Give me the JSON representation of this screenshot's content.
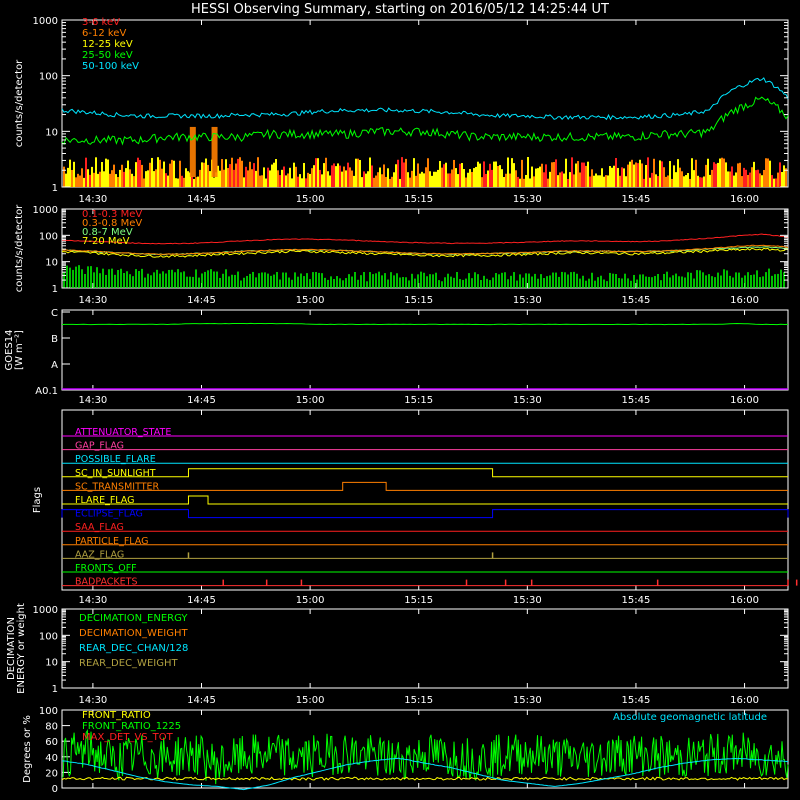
{
  "title": "HESSI Observing Summary, starting on 2016/05/12 14:25:44 UT",
  "time_ticks": [
    "14:30",
    "14:45",
    "15:00",
    "15:15",
    "15:30",
    "15:45",
    "16:00"
  ],
  "colors": {
    "background": "#000000",
    "axes": "#ffffff",
    "red": "#ff2020",
    "orange": "#ff7f00",
    "yellow": "#ffff00",
    "green": "#00ff00",
    "cyan": "#00e5ff",
    "magenta": "#ff00ff",
    "blue": "#0000ff",
    "olive": "#b0a040",
    "pink": "#ff40a0",
    "purple": "#c000ff",
    "lightgreen": "#80ff80",
    "darkred": "#ff3030"
  },
  "chart_data": [
    {
      "id": "low-energy",
      "type": "line",
      "ylabel": "counts/s/detector",
      "yscale": "log",
      "ylim": [
        1,
        1000
      ],
      "yticks": [
        "1",
        "10",
        "100",
        "1000"
      ],
      "series": [
        {
          "name": "3-6 keV",
          "color": "red",
          "values": [
            1,
            2,
            2,
            1,
            2,
            4,
            2,
            1,
            1,
            2,
            1,
            1,
            1,
            1,
            1,
            1,
            1,
            1,
            1,
            1,
            1,
            1,
            1,
            1,
            2,
            2,
            3,
            2,
            1
          ]
        },
        {
          "name": "6-12 keV",
          "color": "orange",
          "values": [
            2,
            2,
            2,
            2,
            3,
            12,
            12,
            2,
            2,
            2,
            2,
            2,
            2,
            2,
            2,
            2,
            2,
            2,
            2,
            2,
            2,
            2,
            2,
            2,
            2,
            2,
            2,
            2,
            2
          ]
        },
        {
          "name": "12-25 keV",
          "color": "yellow",
          "values": [
            2,
            2,
            2,
            2,
            2,
            3,
            3,
            2,
            2,
            2,
            2,
            2,
            2,
            2,
            2,
            2,
            2,
            2,
            2,
            2,
            2,
            2,
            2,
            2,
            2,
            2,
            3,
            3,
            2
          ]
        },
        {
          "name": "25-50 keV",
          "color": "green",
          "values": [
            7,
            7,
            7,
            7,
            8,
            8,
            8,
            8,
            9,
            9,
            9,
            9,
            10,
            10,
            10,
            9,
            8,
            8,
            8,
            8,
            8,
            8,
            8,
            9,
            9,
            10,
            25,
            38,
            18
          ]
        },
        {
          "name": "50-100 keV",
          "color": "cyan",
          "values": [
            24,
            22,
            20,
            19,
            19,
            19,
            19,
            20,
            20,
            21,
            23,
            24,
            24,
            24,
            23,
            22,
            20,
            19,
            19,
            18,
            18,
            18,
            18,
            19,
            20,
            24,
            60,
            90,
            40
          ]
        }
      ]
    },
    {
      "id": "high-energy",
      "type": "line",
      "ylabel": "counts/s/detector",
      "yscale": "log",
      "ylim": [
        1,
        1000
      ],
      "yticks": [
        "1",
        "10",
        "100",
        "1000"
      ],
      "series": [
        {
          "name": "0.1-0.3 MeV",
          "color": "red",
          "values": [
            65,
            60,
            55,
            50,
            48,
            50,
            55,
            62,
            68,
            72,
            70,
            66,
            60,
            55,
            52,
            50,
            50,
            52,
            55,
            60,
            62,
            60,
            58,
            60,
            68,
            78,
            95,
            110,
            85
          ]
        },
        {
          "name": "0.3-0.8 MeV",
          "color": "orange",
          "values": [
            28,
            26,
            22,
            20,
            19,
            20,
            22,
            25,
            27,
            29,
            28,
            26,
            24,
            22,
            20,
            20,
            20,
            21,
            22,
            25,
            26,
            25,
            24,
            25,
            28,
            32,
            38,
            42,
            36
          ]
        },
        {
          "name": "0.8-7 MeV",
          "color": "lightgreen",
          "values": [
            28,
            25,
            22,
            20,
            19,
            20,
            22,
            25,
            27,
            28,
            28,
            26,
            24,
            22,
            20,
            19,
            20,
            21,
            22,
            24,
            25,
            25,
            24,
            25,
            27,
            30,
            34,
            36,
            32
          ]
        },
        {
          "name": "7-20 MeV",
          "color": "yellow",
          "values": [
            24,
            22,
            19,
            17,
            16,
            17,
            19,
            21,
            23,
            25,
            24,
            22,
            20,
            19,
            17,
            17,
            17,
            18,
            19,
            21,
            22,
            21,
            20,
            21,
            23,
            26,
            28,
            30,
            27
          ]
        },
        {
          "name": "",
          "color": "green",
          "values": [
            6,
            5,
            5,
            4,
            4,
            4,
            4,
            3,
            3,
            3,
            3,
            3,
            3,
            3,
            3,
            3,
            3,
            3,
            3,
            3,
            3,
            3,
            3,
            3,
            3,
            4,
            4,
            4,
            4
          ]
        }
      ]
    },
    {
      "id": "goes",
      "type": "line",
      "ylabel": "GOES14",
      "ylabel2": "[W m⁻²]",
      "yticks": [
        "A0.1",
        "A",
        "B",
        "C"
      ],
      "series": [
        {
          "name": "",
          "color": "green",
          "values": [
            0.82,
            0.82,
            0.82,
            0.82,
            0.82,
            0.83,
            0.83,
            0.83,
            0.83,
            0.83,
            0.82,
            0.82,
            0.82,
            0.82,
            0.82,
            0.82,
            0.82,
            0.82,
            0.82,
            0.82,
            0.82,
            0.82,
            0.82,
            0.82,
            0.82,
            0.82,
            0.83,
            0.82,
            0.82
          ]
        }
      ]
    },
    {
      "id": "flags",
      "type": "line",
      "ylabel": "Flags",
      "flags": [
        {
          "label": "ATTENUATOR_STATE",
          "color": "magenta"
        },
        {
          "label": "GAP_FLAG",
          "color": "pink"
        },
        {
          "label": "POSSIBLE_FLARE",
          "color": "cyan"
        },
        {
          "label": "SC_IN_SUNLIGHT",
          "color": "yellow",
          "high_intervals": [
            [
              14.72,
              15.42
            ]
          ]
        },
        {
          "label": "SC_TRANSMITTER",
          "color": "orange",
          "high_intervals": [
            [
              15.075,
              15.175
            ]
          ]
        },
        {
          "label": "FLARE_FLAG",
          "color": "yellow",
          "high_intervals": [
            [
              14.72,
              14.765
            ]
          ]
        },
        {
          "label": "ECLIPSE_FLAG",
          "color": "blue",
          "high_intervals": [
            [
              14.37,
              14.72
            ],
            [
              15.42,
              16.1
            ]
          ]
        },
        {
          "label": "SAA_FLAG",
          "color": "red"
        },
        {
          "label": "PARTICLE_FLAG",
          "color": "orange"
        },
        {
          "label": "AAZ_FLAG",
          "color": "olive",
          "spikes": [
            14.72,
            15.42
          ]
        },
        {
          "label": "FRONTS_OFF",
          "color": "green"
        },
        {
          "label": "BADPACKETS",
          "color": "darkred",
          "spikes": [
            14.8,
            14.9,
            14.98,
            15.36,
            15.45,
            15.51,
            15.8,
            16.1,
            16.12
          ]
        }
      ]
    },
    {
      "id": "decimation",
      "type": "line",
      "ylabel": "DECIMATION",
      "ylabel2": "ENERGY or weight",
      "yscale": "log",
      "ylim": [
        1,
        1000
      ],
      "yticks": [
        "1",
        "10",
        "100",
        "1000"
      ],
      "series": [
        {
          "name": "DECIMATION_ENERGY",
          "color": "green",
          "values": []
        },
        {
          "name": "DECIMATION_WEIGHT",
          "color": "orange",
          "values": []
        },
        {
          "name": "REAR_DEC_CHAN/128",
          "color": "cyan",
          "values": []
        },
        {
          "name": "REAR_DEC_WEIGHT",
          "color": "olive",
          "values": []
        }
      ]
    },
    {
      "id": "ratios",
      "type": "line",
      "ylabel": "Degrees or %",
      "ylim": [
        0,
        100
      ],
      "yticks": [
        "0",
        "20",
        "40",
        "60",
        "80",
        "100"
      ],
      "series": [
        {
          "name": "FRONT_RATIO",
          "color": "yellow",
          "values": [
            12,
            12,
            12,
            12,
            12,
            12,
            12,
            12,
            12,
            12,
            12,
            12,
            12,
            12,
            12,
            12,
            12,
            12,
            12,
            12,
            12,
            12,
            12,
            12,
            12,
            12,
            12,
            12,
            12
          ]
        },
        {
          "name": "FRONT_RATIO_1225",
          "color": "green",
          "values": [
            40,
            48,
            35,
            42,
            38,
            45,
            30,
            40,
            44,
            38,
            42,
            46,
            40,
            36,
            44,
            40,
            38,
            42,
            45,
            40,
            38,
            42,
            44,
            40,
            38,
            42,
            45,
            40,
            38
          ]
        },
        {
          "name": "MAX_DET_VS_TOT",
          "color": "red",
          "values": []
        },
        {
          "name": "Absolute geomagnetic latitude",
          "color": "cyan",
          "values": [
            35,
            30,
            22,
            14,
            8,
            4,
            2,
            -2,
            4,
            14,
            22,
            30,
            35,
            38,
            32,
            26,
            18,
            10,
            6,
            2,
            6,
            12,
            18,
            26,
            32,
            36,
            38,
            36,
            34
          ]
        }
      ]
    }
  ]
}
